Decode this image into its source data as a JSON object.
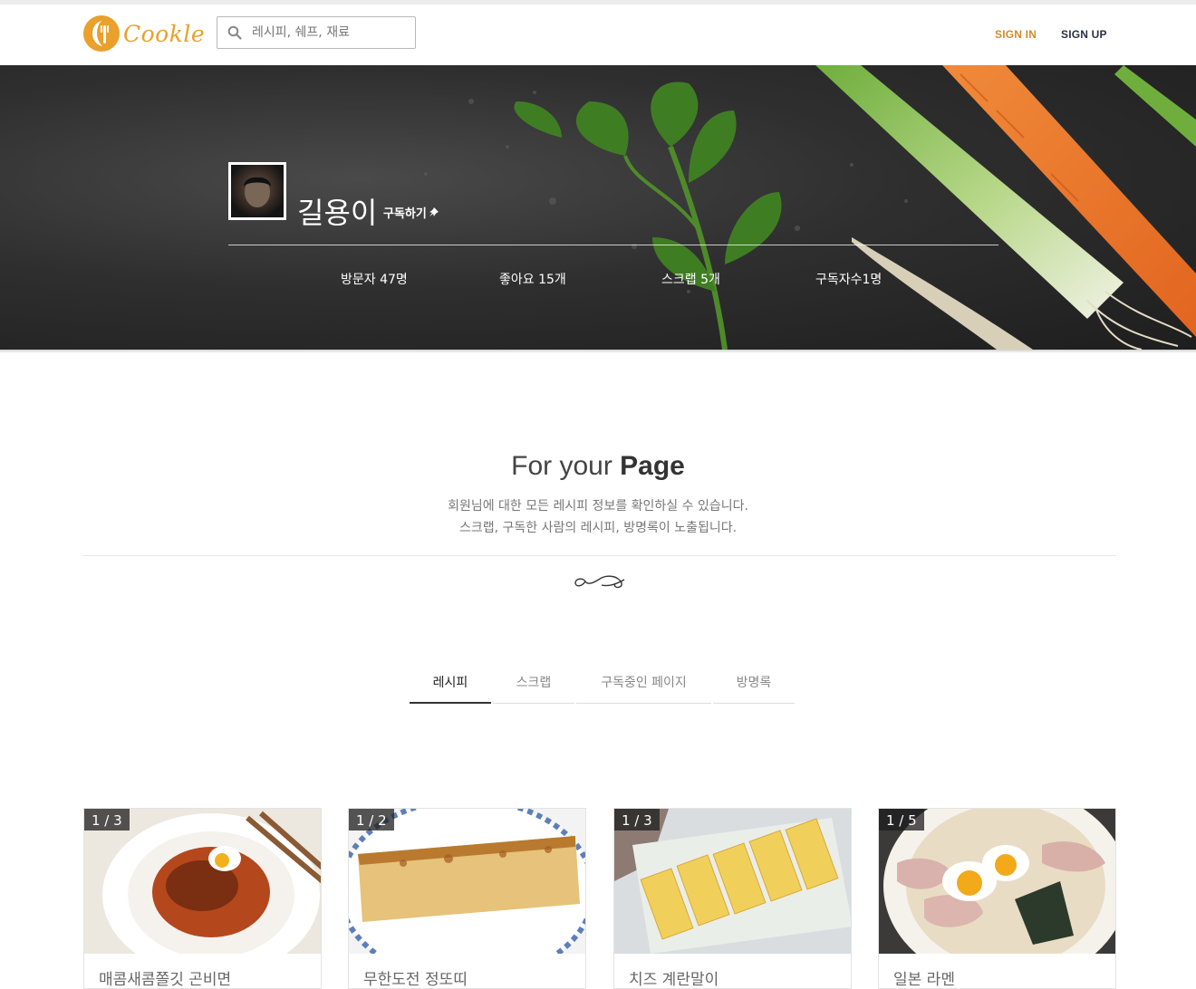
{
  "header": {
    "logo_text": "Cookle",
    "search_placeholder": "레시피, 쉐프, 재료",
    "sign_in": "SIGN IN",
    "sign_up": "SIGN UP",
    "accent_color": "#e9a02c"
  },
  "profile": {
    "name": "길용이",
    "subscribe_label": "구독하기",
    "stats": [
      {
        "label": "방문자 47명"
      },
      {
        "label": "좋아요 15개"
      },
      {
        "label": "스크랩 5개"
      },
      {
        "label": "구독자수1명"
      }
    ]
  },
  "section": {
    "title_light": "For your ",
    "title_bold": "Page",
    "desc_line1": "회원님에 대한 모든 레시피 정보를 확인하실 수 있습니다.",
    "desc_line2": "스크랩, 구독한 사람의 레시피, 방명록이 노출됩니다."
  },
  "tabs": [
    {
      "label": "레시피",
      "active": true
    },
    {
      "label": "스크랩",
      "active": false
    },
    {
      "label": "구독중인 페이지",
      "active": false
    },
    {
      "label": "방명록",
      "active": false
    }
  ],
  "recipes": [
    {
      "counter": "1 / 3",
      "title": "매콤새콤쫄깃 곤비면"
    },
    {
      "counter": "1 / 2",
      "title": "무한도전 정또띠"
    },
    {
      "counter": "1 / 3",
      "title": "치즈 계란말이"
    },
    {
      "counter": "1 / 5",
      "title": "일본 라멘"
    }
  ]
}
